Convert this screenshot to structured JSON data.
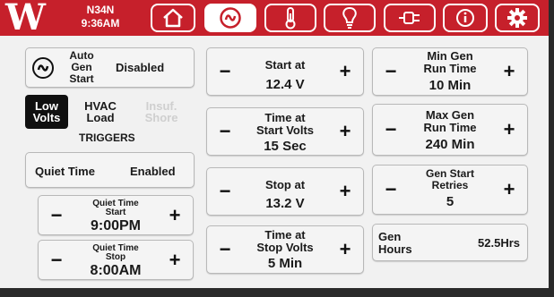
{
  "header": {
    "logo": "W",
    "unit_name": "N34N",
    "time": "9:36AM",
    "tabs": [
      {
        "name": "home-tab",
        "icon": "home-icon"
      },
      {
        "name": "gen-start-tab",
        "icon": "generator-icon",
        "active": true
      },
      {
        "name": "temperature-tab",
        "icon": "thermometer-icon"
      },
      {
        "name": "lighting-tab",
        "icon": "lightbulb-icon"
      },
      {
        "name": "power-tab",
        "icon": "plug-icon"
      },
      {
        "name": "info-tab",
        "icon": "info-icon"
      },
      {
        "name": "settings-tab",
        "icon": "gear-icon"
      }
    ],
    "colors": {
      "bar": "#c6202b",
      "tab_border": "#ffffff"
    }
  },
  "auto_gen_start": {
    "label_line1": "Auto",
    "label_line2": "Gen",
    "label_line3": "Start",
    "value": "Disabled"
  },
  "triggers": {
    "title": "TRIGGERS",
    "low_volts": {
      "line1": "Low",
      "line2": "Volts",
      "active": true
    },
    "hvac_load": {
      "line1": "HVAC",
      "line2": "Load"
    },
    "insuf_shore": {
      "line1": "Insuf.",
      "line2": "Shore",
      "disabled": true
    }
  },
  "quiet_time": {
    "label": "Quiet Time",
    "value": "Enabled",
    "start": {
      "label_line1": "Quiet Time",
      "label_line2": "Start",
      "value": "9:00PM"
    },
    "stop": {
      "label_line1": "Quiet Time",
      "label_line2": "Stop",
      "value": "8:00AM"
    }
  },
  "middle": {
    "start_at": {
      "label": "Start at",
      "value": "12.4 V"
    },
    "time_at_start_volts": {
      "label_line1": "Time at",
      "label_line2": "Start Volts",
      "value": "15 Sec"
    },
    "stop_at": {
      "label": "Stop at",
      "value": "13.2 V"
    },
    "time_at_stop_volts": {
      "label_line1": "Time at",
      "label_line2": "Stop Volts",
      "value": "5 Min"
    }
  },
  "right": {
    "min_gen_run_time": {
      "label_line1": "Min Gen",
      "label_line2": "Run Time",
      "value": "10 Min"
    },
    "max_gen_run_time": {
      "label_line1": "Max Gen",
      "label_line2": "Run Time",
      "value": "240 Min"
    },
    "gen_start_retries": {
      "label_line1": "Gen Start",
      "label_line2": "Retries",
      "value": "5"
    },
    "gen_hours": {
      "label_line1": "Gen",
      "label_line2": "Hours",
      "value": "52.5Hrs"
    }
  },
  "buttons": {
    "minus": "−",
    "plus": "+"
  }
}
